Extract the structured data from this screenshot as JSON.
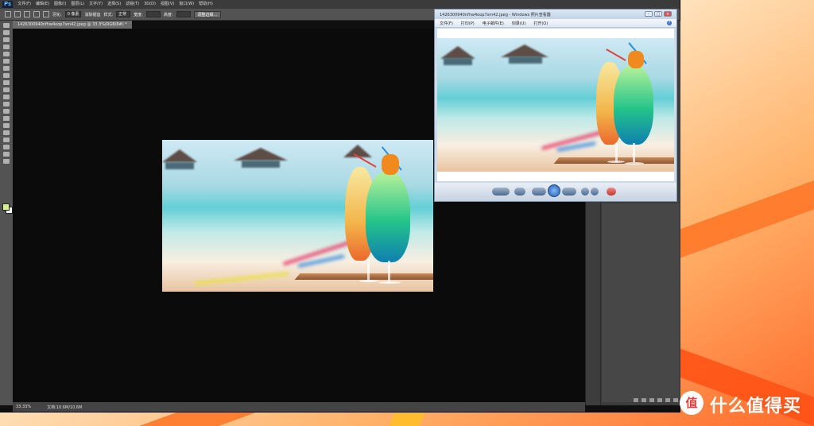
{
  "photoshop": {
    "logo": "Ps",
    "menus": [
      "文件(F)",
      "编辑(E)",
      "图像(I)",
      "图层(L)",
      "文字(Y)",
      "选择(S)",
      "滤镜(T)",
      "3D(D)",
      "视图(V)",
      "窗口(W)",
      "帮助(H)"
    ],
    "options": {
      "feather_label": "羽化:",
      "feather_value": "0 像素",
      "antialias_label": "消除锯齿",
      "style_label": "样式:",
      "style_value": "正常",
      "width_label": "宽度:",
      "height_label": "高度:",
      "refine_edge_button": "调整边缘..."
    },
    "document_tab": "1426300940nfhw4oop7sm42.jpeg @ 33.3%(RGB/8#) *",
    "status": {
      "zoom": "33.33%",
      "doc_size": "文档:10.6M/10.6M"
    },
    "foreground_color": "#d8f08a",
    "background_color": "#ffffff"
  },
  "viewer": {
    "title": "1426300940nfhw4oop7sm42.jpeg - Windows 照片查看器",
    "menus": [
      "文件(F)",
      "打印(P)",
      "电子邮件(E)",
      "刻录(U)",
      "打开(O)"
    ],
    "help_icon": "?",
    "window_buttons": [
      "–",
      "□",
      "×"
    ],
    "controls": [
      "zoom-icon",
      "fit-window-icon",
      "previous-icon",
      "slideshow-icon",
      "next-icon",
      "rotate-left-icon",
      "rotate-right-icon",
      "delete-icon"
    ]
  },
  "watermark": {
    "logo_glyph": "值",
    "text": "什么值得买"
  }
}
